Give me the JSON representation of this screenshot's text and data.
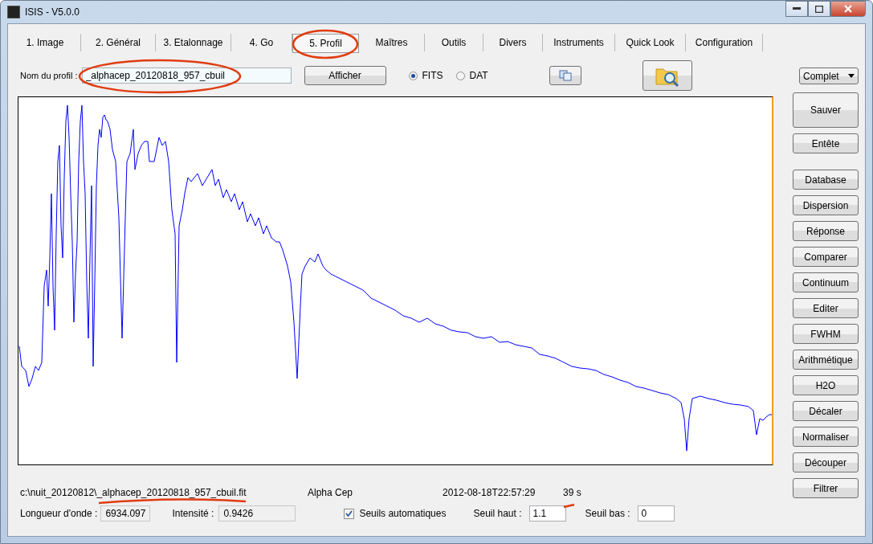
{
  "window": {
    "title": "ISIS - V5.0.0"
  },
  "tabs": [
    {
      "label": "1. Image",
      "selected": false
    },
    {
      "label": "2. Général",
      "selected": false
    },
    {
      "label": "3. Etalonnage",
      "selected": false
    },
    {
      "label": "4. Go",
      "selected": false
    },
    {
      "label": "5. Profil",
      "selected": true
    },
    {
      "label": "Maîtres",
      "selected": false
    },
    {
      "label": "Outils",
      "selected": false
    },
    {
      "label": "Divers",
      "selected": false
    },
    {
      "label": "Instruments",
      "selected": false
    },
    {
      "label": "Quick Look",
      "selected": false
    },
    {
      "label": "Configuration",
      "selected": false
    }
  ],
  "profile": {
    "label": "Nom du profil :",
    "value": "_alphacep_20120818_957_cbuil",
    "show_button": "Afficher",
    "formats": [
      {
        "label": "FITS",
        "selected": true
      },
      {
        "label": "DAT",
        "selected": false
      }
    ]
  },
  "mode_select": {
    "value": "Complet"
  },
  "side_buttons": [
    {
      "label": "Sauver",
      "kind": "large"
    },
    {
      "label": "Entête",
      "kind": "normal"
    },
    {
      "label": "Database",
      "kind": "spaced"
    },
    {
      "label": "Dispersion",
      "kind": "normal"
    },
    {
      "label": "Réponse",
      "kind": "normal"
    },
    {
      "label": "Comparer",
      "kind": "normal"
    },
    {
      "label": "Continuum",
      "kind": "normal"
    },
    {
      "label": "Editer",
      "kind": "normal"
    },
    {
      "label": "FWHM",
      "kind": "normal"
    },
    {
      "label": "Arithmétique",
      "kind": "normal"
    },
    {
      "label": "H2O",
      "kind": "normal"
    },
    {
      "label": "Décaler",
      "kind": "normal"
    },
    {
      "label": "Normaliser",
      "kind": "normal"
    },
    {
      "label": "Découper",
      "kind": "normal"
    },
    {
      "label": "Filtrer",
      "kind": "normal"
    }
  ],
  "info": {
    "path": "c:\\nuit_20120812\\_alphacep_20120818_957_cbuil.fit",
    "object": "Alpha Cep",
    "date": "2012-08-18T22:57:29",
    "exposure": "39 s"
  },
  "readouts": [
    {
      "label": "Longueur d'onde :",
      "value": "6934.097"
    },
    {
      "label": "Intensité :",
      "value": "0.9426"
    }
  ],
  "auto_thresholds": {
    "label": "Seuils automatiques",
    "checked": true
  },
  "thresholds": [
    {
      "label": "Seuil haut :",
      "value": "1.1"
    },
    {
      "label": "Seuil bas :",
      "value": "0"
    }
  ]
}
